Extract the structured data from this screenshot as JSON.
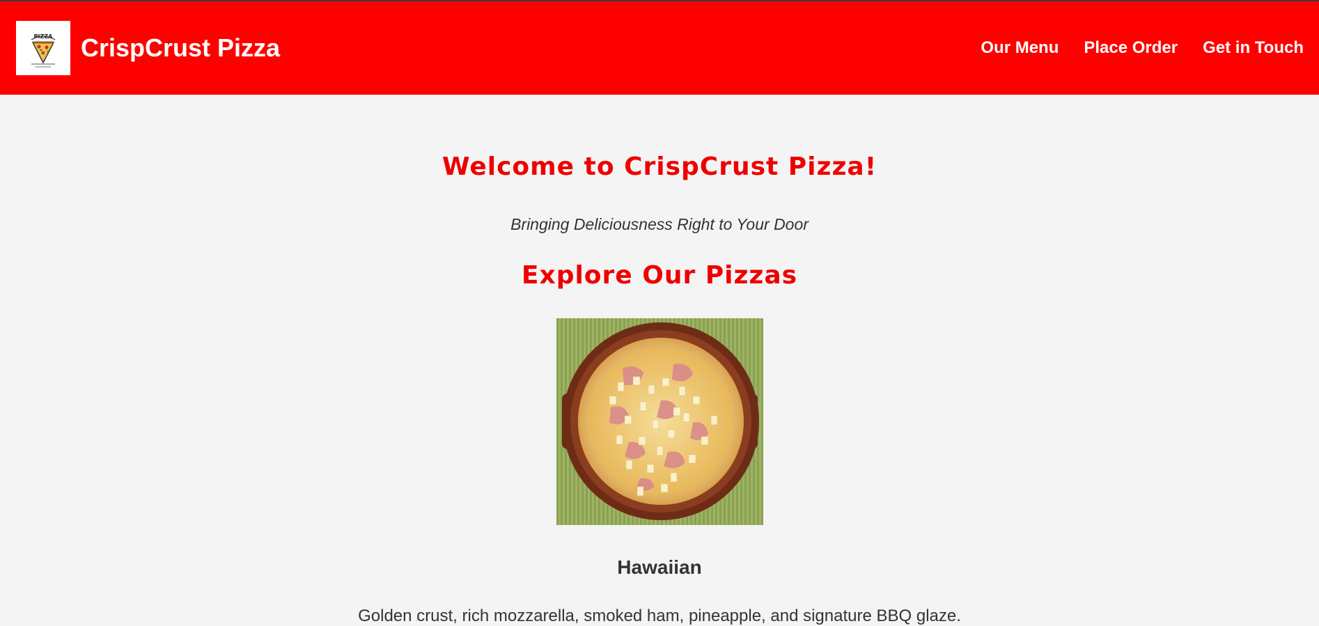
{
  "header": {
    "title": "CrispCrust Pizza",
    "logo_text": "PIZZA",
    "nav": {
      "menu": "Our Menu",
      "order": "Place Order",
      "contact": "Get in Touch"
    }
  },
  "main": {
    "welcome": "Welcome to CrispCrust Pizza!",
    "tagline": "Bringing Deliciousness Right to Your Door",
    "section_title": "Explore Our Pizzas",
    "pizza": {
      "name": "Hawaiian",
      "description": "Golden crust, rich mozzarella, smoked ham, pineapple, and signature BBQ glaze."
    }
  },
  "colors": {
    "brand_red": "#ff0000",
    "heading_red": "#ee0000",
    "background": "#f4f4f4",
    "text": "#333333"
  }
}
